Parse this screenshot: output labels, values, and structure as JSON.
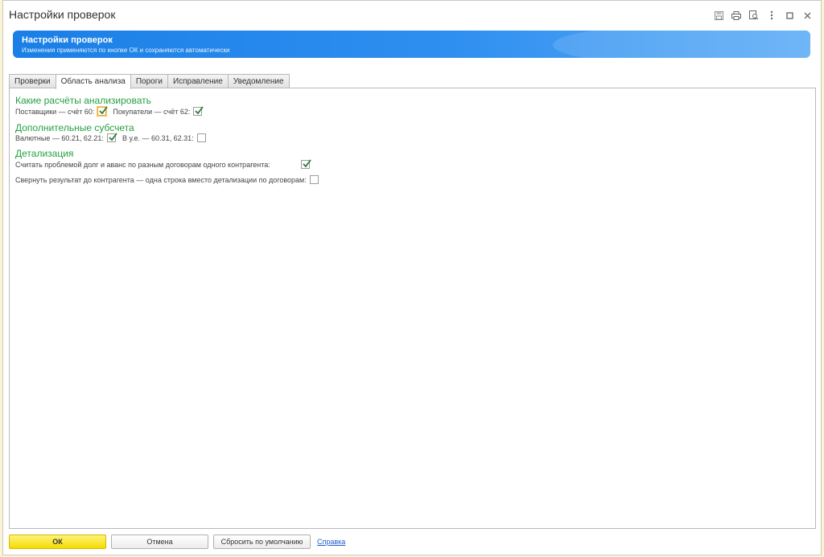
{
  "window": {
    "title": "Настройки проверок"
  },
  "banner": {
    "title": "Настройки проверок",
    "subtitle": "Изменения применяются по кнопке ОК и сохраняются автоматически"
  },
  "tabs": [
    {
      "label": "Проверки",
      "active": false
    },
    {
      "label": "Область анализа",
      "active": true
    },
    {
      "label": "Пороги",
      "active": false
    },
    {
      "label": "Исправление",
      "active": false
    },
    {
      "label": "Уведомление",
      "active": false
    }
  ],
  "sections": {
    "accounts": {
      "title": "Какие расчёты анализировать",
      "suppliers_label": "Поставщики — счёт 60:",
      "suppliers_checked": true,
      "customers_label": "Покупатели — счёт 62:",
      "customers_checked": true
    },
    "subaccounts": {
      "title": "Дополнительные субсчета",
      "currency_label": "Валютные — 60.21, 62.21:",
      "currency_checked": true,
      "cu_label": "В у.е. — 60.31, 62.31:",
      "cu_checked": false
    },
    "detail": {
      "title": "Детализация",
      "debt_advance_label": "Считать проблемой долг и аванс по разным договорам одного контрагента:",
      "debt_advance_checked": true,
      "collapse_label": "Свернуть результат до контрагента — одна строка вместо детализации по договорам:",
      "collapse_checked": false
    }
  },
  "footer": {
    "ok": "ОК",
    "cancel": "Отмена",
    "reset": "Сбросить по умолчанию",
    "help": "Справка"
  },
  "colors": {
    "accent_green": "#26a042",
    "banner_blue": "#1a7fe6",
    "ok_yellow": "#f4dc00",
    "link_blue": "#1f5bd1"
  }
}
